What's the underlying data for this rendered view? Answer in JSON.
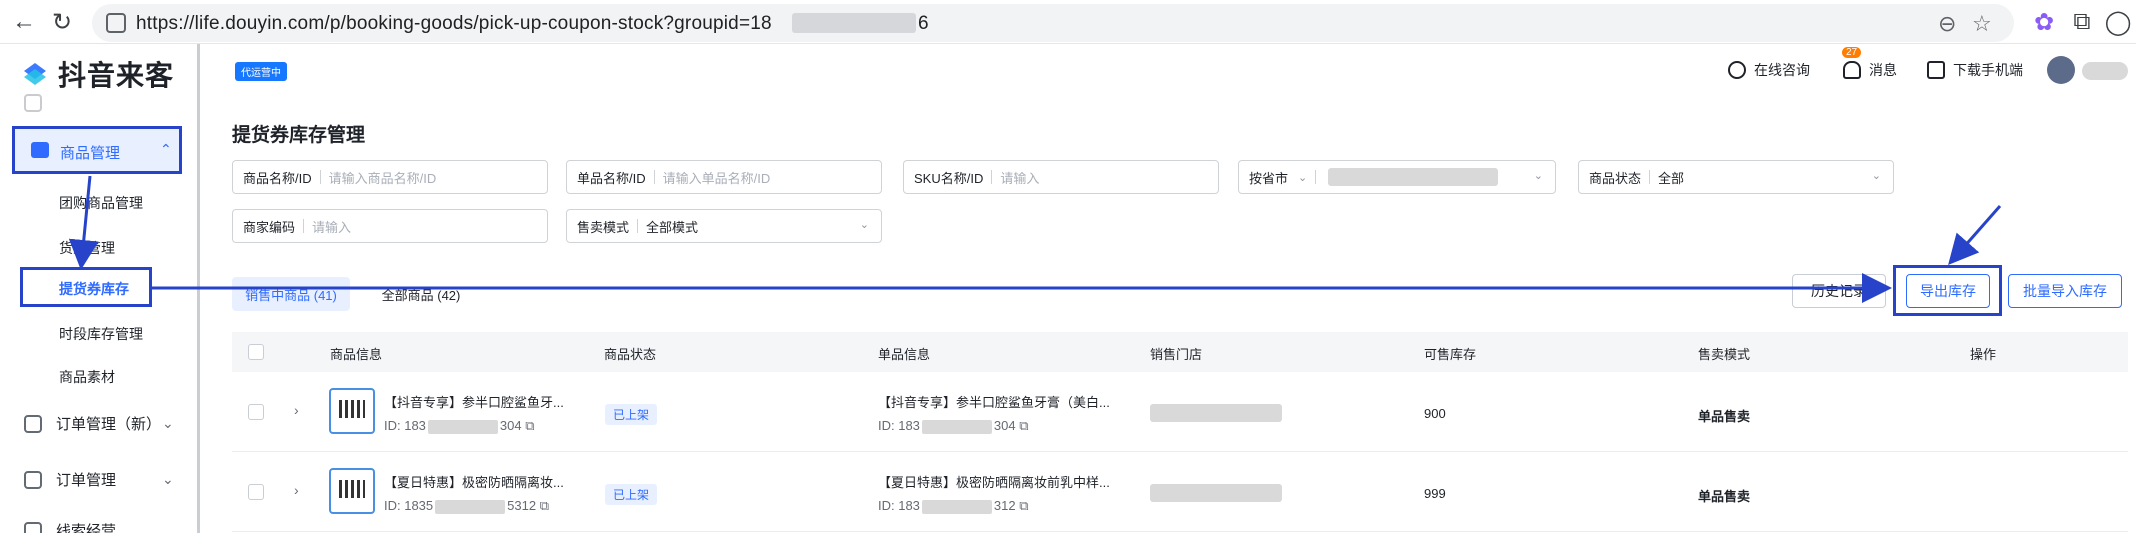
{
  "browser": {
    "url_prefix": "https://life.douyin.com/p/booking-goods/pick-up-coupon-stock?groupid=18",
    "url_suffix": "6"
  },
  "app": {
    "logo_text": "抖音来客",
    "header_tag": "代运营中",
    "online_consult": "在线咨询",
    "messages": "消息",
    "message_count": "27",
    "download_app": "下载手机端"
  },
  "sidebar": {
    "groups": [
      {
        "label": "商品管理",
        "expanded": true
      },
      {
        "label": "订单管理（新）"
      },
      {
        "label": "订单管理"
      },
      {
        "label": "线索经营"
      }
    ],
    "sub_items": [
      {
        "label": "团购商品管理"
      },
      {
        "label": "货架管理"
      },
      {
        "label": "提货券库存",
        "active": true
      },
      {
        "label": "时段库存管理"
      },
      {
        "label": "商品素材"
      }
    ]
  },
  "main": {
    "title": "提货券库存管理",
    "filters": {
      "product_name": {
        "label": "商品名称/ID",
        "placeholder": "请输入商品名称/ID"
      },
      "single_name": {
        "label": "单品名称/ID",
        "placeholder": "请输入单品名称/ID"
      },
      "sku_name": {
        "label": "SKU名称/ID",
        "placeholder": "请输入"
      },
      "region": {
        "label": "按省市"
      },
      "product_status": {
        "label": "商品状态",
        "value": "全部"
      },
      "merchant_code": {
        "label": "商家编码",
        "placeholder": "请输入"
      },
      "sale_mode": {
        "label": "售卖模式",
        "value": "全部模式"
      }
    },
    "tabs": [
      {
        "label": "销售中商品 (41)"
      },
      {
        "label": "全部商品 (42)"
      }
    ],
    "buttons": {
      "history": "历史记录",
      "export": "导出库存",
      "batch_import": "批量导入库存"
    },
    "table": {
      "columns": [
        "商品信息",
        "商品状态",
        "单品信息",
        "销售门店",
        "可售库存",
        "售卖模式",
        "操作"
      ],
      "rows": [
        {
          "product_title": "【抖音专享】参半口腔鲨鱼牙...",
          "product_id_prefix": "ID: 183",
          "product_id_suffix": "304",
          "status": "已上架",
          "single_title": "【抖音专享】参半口腔鲨鱼牙膏（美白...",
          "single_id_prefix": "ID: 183",
          "single_id_suffix": "304",
          "stock": "900",
          "sale_mode": "单品售卖"
        },
        {
          "product_title": "【夏日特惠】极密防晒隔离妆...",
          "product_id_prefix": "ID: 1835",
          "product_id_suffix": "5312",
          "status": "已上架",
          "single_title": "【夏日特惠】极密防晒隔离妆前乳中样...",
          "single_id_prefix": "ID: 183",
          "single_id_suffix": "312",
          "stock": "999",
          "sale_mode": "单品售卖"
        }
      ]
    }
  },
  "colors": {
    "accent": "#2f6bff",
    "annotation": "#2643c9"
  }
}
